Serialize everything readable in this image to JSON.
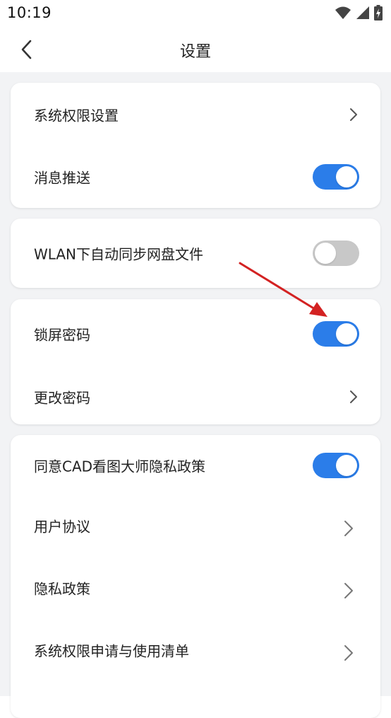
{
  "status_bar": {
    "time": "10:19",
    "icons": [
      "wifi-icon",
      "signal-icon",
      "battery-charging-icon"
    ]
  },
  "header": {
    "title": "设置",
    "back_icon": "chevron-left-icon"
  },
  "colors": {
    "accent": "#2b7de9",
    "toggle_off": "#c8c8c8",
    "background": "#f2f3f5",
    "annotation_arrow": "#d32222"
  },
  "cards": [
    {
      "rows": [
        {
          "label": "系统权限设置",
          "type": "chevron"
        },
        {
          "label": "消息推送",
          "type": "toggle",
          "on": true
        }
      ]
    },
    {
      "rows": [
        {
          "label": "WLAN下自动同步网盘文件",
          "type": "toggle",
          "on": false
        }
      ]
    },
    {
      "rows": [
        {
          "label": "锁屏密码",
          "type": "toggle",
          "on": true
        },
        {
          "label": "更改密码",
          "type": "chevron"
        }
      ]
    },
    {
      "rows": [
        {
          "label": "同意CAD看图大师隐私政策",
          "type": "toggle",
          "on": true
        },
        {
          "label": "用户协议",
          "type": "chevron"
        },
        {
          "label": "隐私政策",
          "type": "chevron"
        },
        {
          "label": "系统权限申请与使用清单",
          "type": "chevron"
        }
      ]
    }
  ]
}
